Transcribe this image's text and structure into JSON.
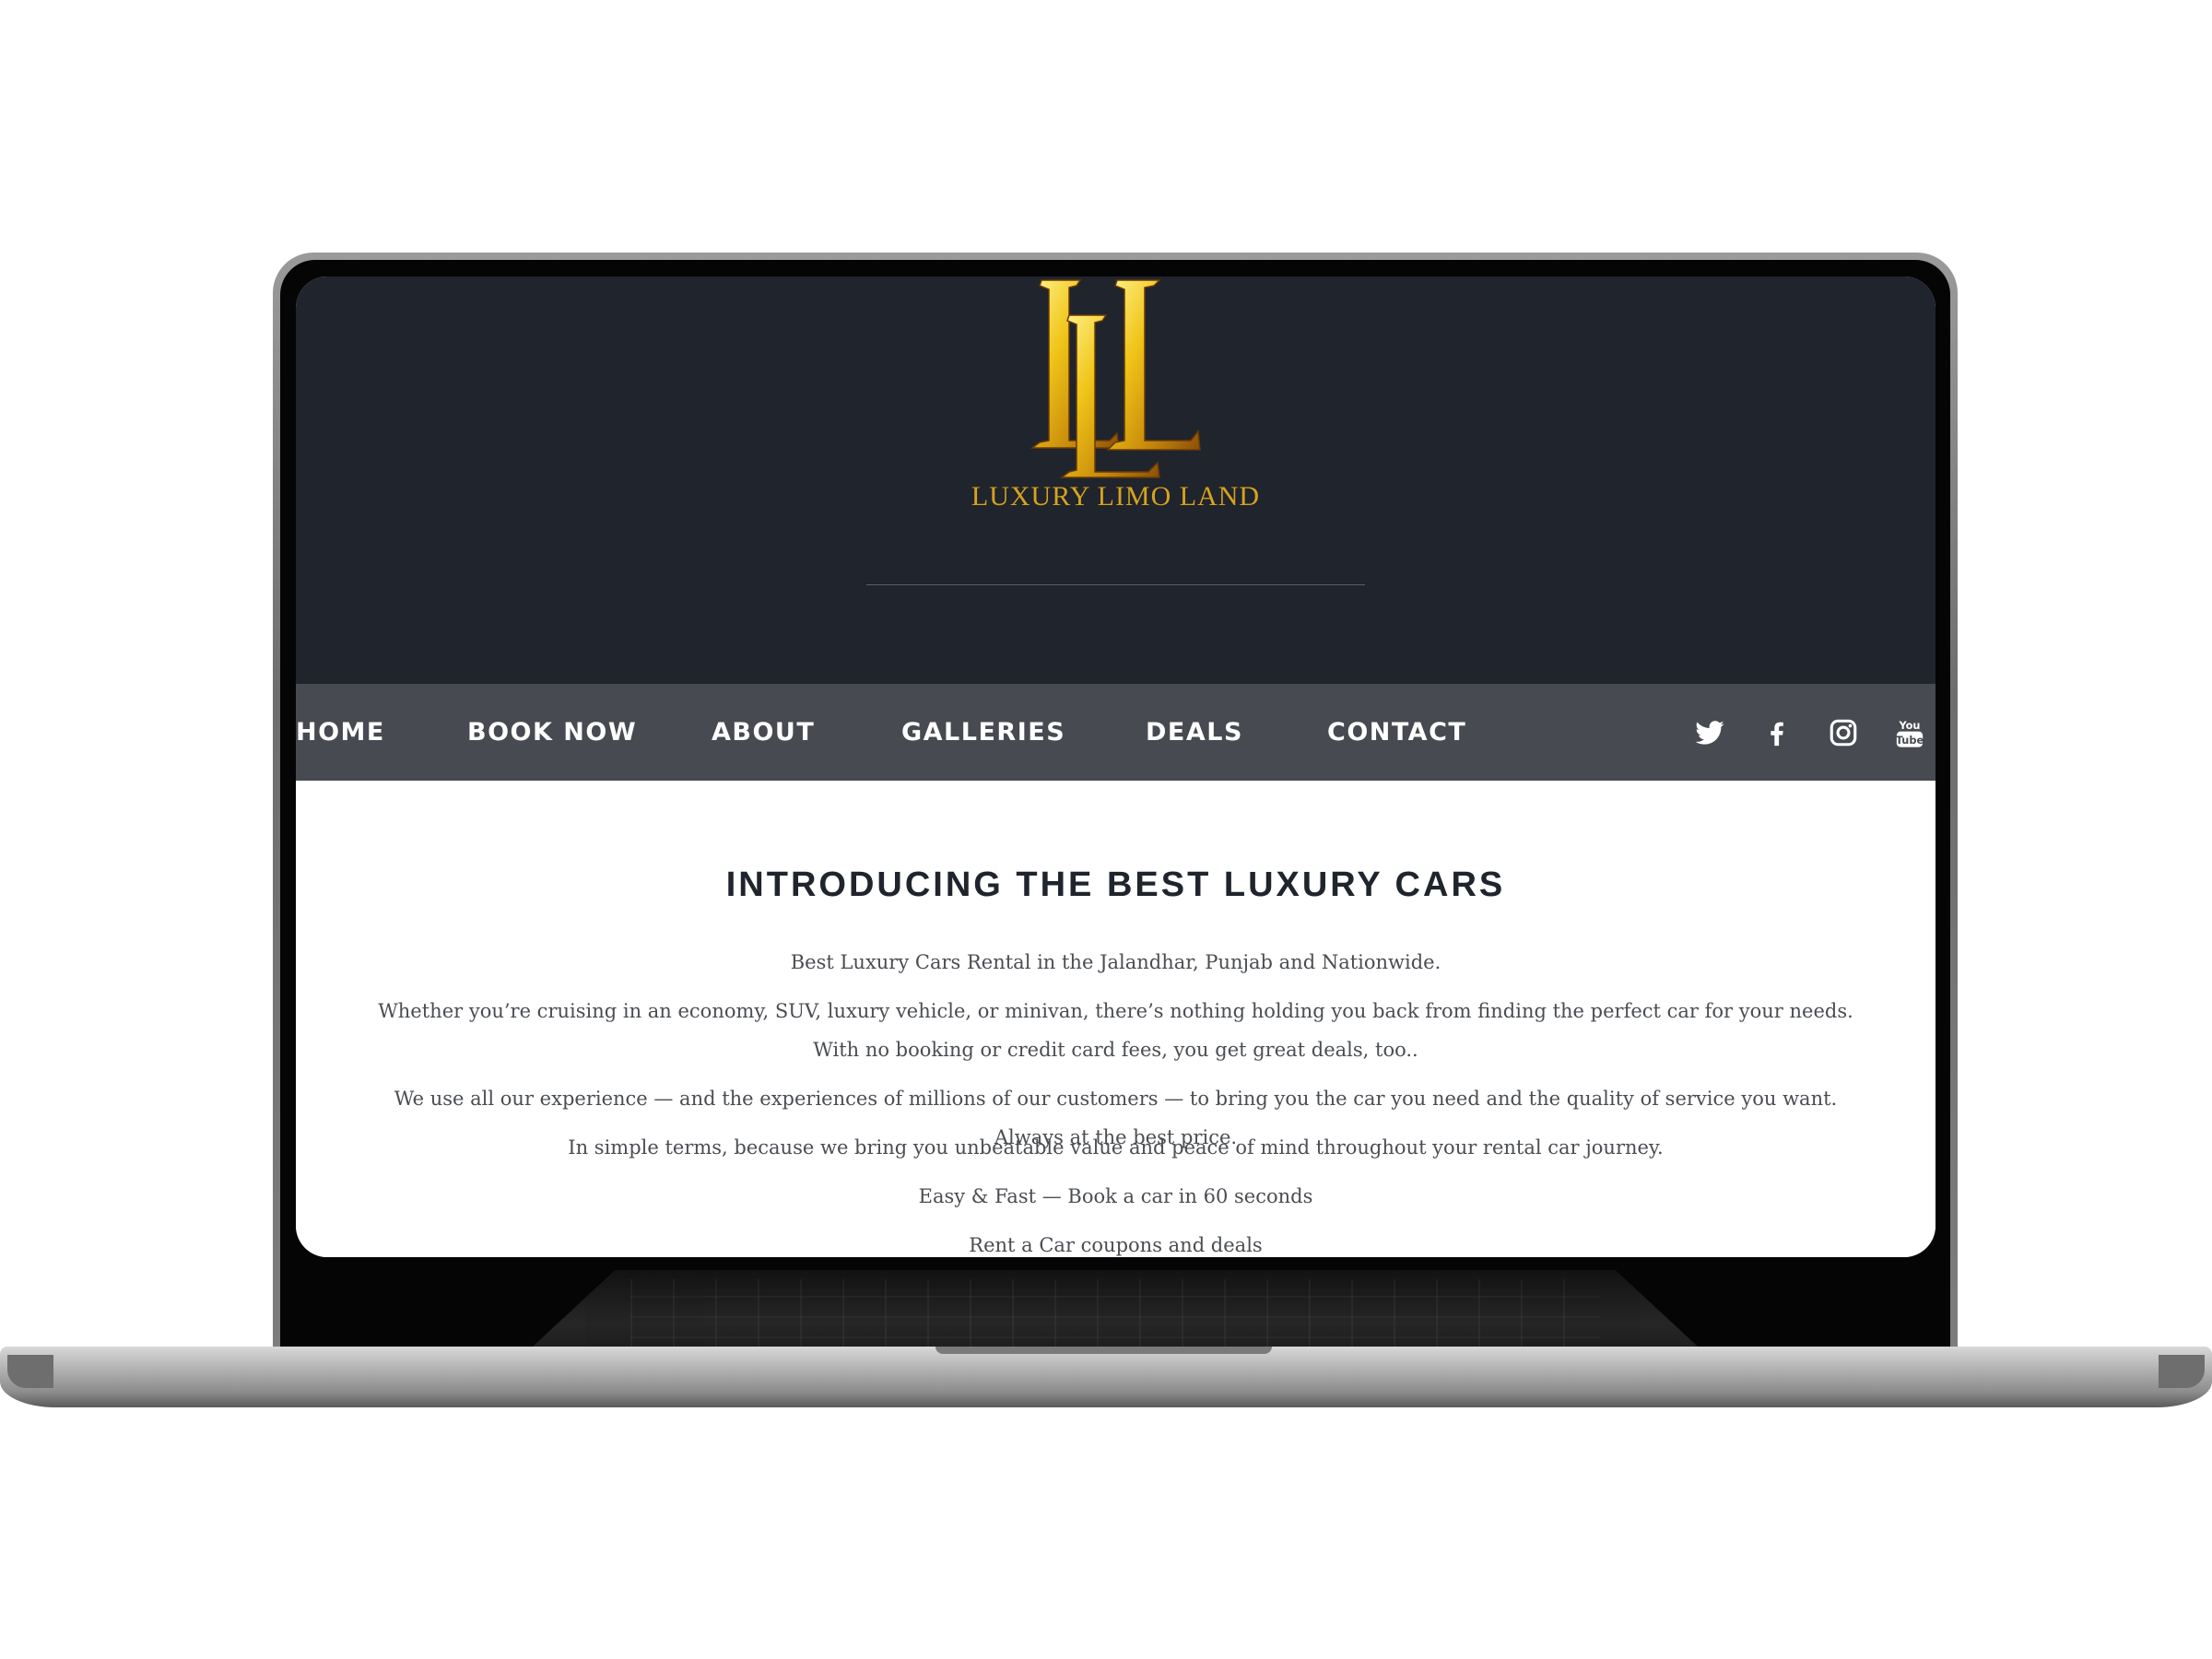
{
  "brand": {
    "name": "LUXURY LIMO LAND",
    "logo_mark": "LL monogram",
    "gold": "#d7a31e"
  },
  "nav": {
    "items": [
      "HOME",
      "BOOK NOW",
      "ABOUT",
      "GALLERIES",
      "DEALS",
      "CONTACT"
    ],
    "social_icons": [
      "twitter-icon",
      "facebook-icon",
      "instagram-icon",
      "youtube-icon"
    ],
    "background": "#474a50"
  },
  "header": {
    "background": "#20242c"
  },
  "main": {
    "headline": "INTRODUCING THE BEST LUXURY CARS",
    "paragraphs": [
      "Best Luxury Cars Rental in the Jalandhar, Punjab and Nationwide.",
      "Whether you’re cruising in an economy, SUV, luxury vehicle, or minivan, there’s nothing holding you back from finding the perfect car for your needs. With no booking or credit card fees, you get great deals, too..",
      "We use all our experience — and the experiences of millions of our customers — to bring you the car you need and the quality of service you want. Always at the best price.",
      "In simple terms, because we bring you unbeatable value and peace of mind throughout your rental car journey.",
      "Easy & Fast — Book a car in 60 seconds",
      "Rent a Car coupons and deals"
    ]
  }
}
